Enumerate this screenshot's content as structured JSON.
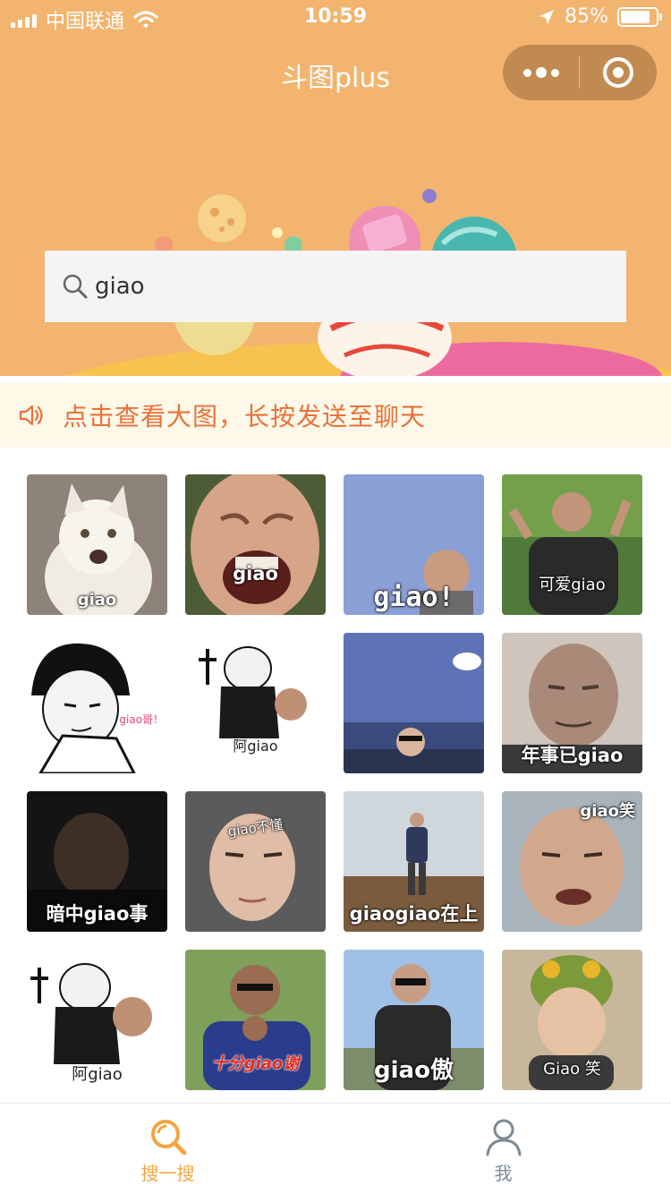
{
  "status_bar": {
    "carrier": "中国联通",
    "time": "10:59",
    "battery": "85%",
    "battery_level": 0.85
  },
  "nav": {
    "title": "斗图plus"
  },
  "search": {
    "value": "giao",
    "placeholder": ""
  },
  "notice": {
    "text": "点击查看大图，长按发送至聊天"
  },
  "stickers": [
    {
      "caption": "giao"
    },
    {
      "caption": "giao"
    },
    {
      "caption": "giao!"
    },
    {
      "caption": "可爱giao"
    },
    {
      "caption": "giao哥！"
    },
    {
      "caption": "阿giao"
    },
    {
      "caption": ""
    },
    {
      "caption": "年事已giao"
    },
    {
      "caption": "暗中giao事"
    },
    {
      "caption": "giao不懂"
    },
    {
      "caption": "giaogiao在上"
    },
    {
      "caption": "giao笑"
    },
    {
      "caption": "阿giao"
    },
    {
      "caption": "十分giao谢"
    },
    {
      "caption": "giao傲"
    },
    {
      "caption": "Giao 笑"
    }
  ],
  "tabs": [
    {
      "label": "搜一搜",
      "icon": "search-icon",
      "active": true
    },
    {
      "label": "我",
      "icon": "user-icon",
      "active": false
    }
  ],
  "colors": {
    "theme": "#f2b46e",
    "accent": "#f2a545",
    "notice_text": "#e8723a",
    "notice_bg": "#fef8e8"
  }
}
